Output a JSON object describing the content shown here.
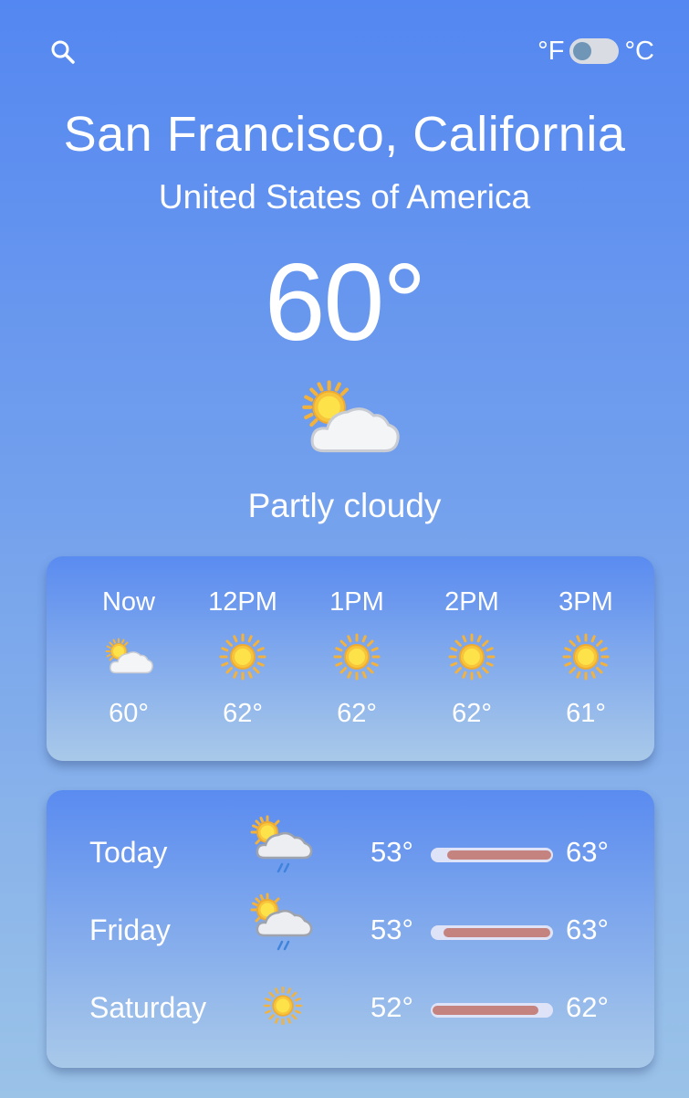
{
  "header": {
    "unit_f": "°F",
    "unit_c": "°C",
    "selected_unit": "F"
  },
  "location": {
    "city": "San Francisco, California",
    "country": "United States of America"
  },
  "current": {
    "temperature": "60°",
    "condition": "Partly cloudy",
    "icon": "partly-cloudy-icon"
  },
  "hourly": [
    {
      "label": "Now",
      "temp": "60°",
      "icon": "partly-cloudy-icon"
    },
    {
      "label": "12PM",
      "temp": "62°",
      "icon": "sun-icon"
    },
    {
      "label": "1PM",
      "temp": "62°",
      "icon": "sun-icon"
    },
    {
      "label": "2PM",
      "temp": "62°",
      "icon": "sun-icon"
    },
    {
      "label": "3PM",
      "temp": "61°",
      "icon": "sun-icon"
    }
  ],
  "daily": [
    {
      "day": "Today",
      "low": "53°",
      "high": "63°",
      "icon": "partly-cloudy-rain-icon",
      "range_start": 0.12,
      "range_end": 1.0
    },
    {
      "day": "Friday",
      "low": "53°",
      "high": "63°",
      "icon": "partly-cloudy-rain-icon",
      "range_start": 0.09,
      "range_end": 0.99
    },
    {
      "day": "Saturday",
      "low": "52°",
      "high": "62°",
      "icon": "sun-icon",
      "range_start": 0.0,
      "range_end": 0.89
    }
  ],
  "colors": {
    "background_top": "#5487f1",
    "background_bottom": "#9bc3e8",
    "range_bar_fill": "#c4837f",
    "range_bar_track": "#dfe3f7",
    "toggle_knob": "#6f96b7"
  }
}
